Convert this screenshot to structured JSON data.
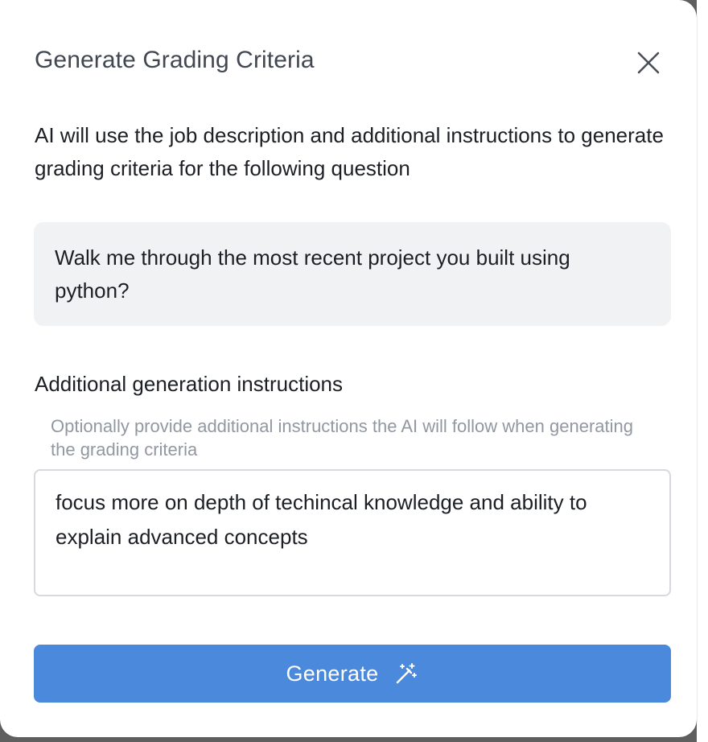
{
  "dialog": {
    "title": "Generate Grading Criteria",
    "close_icon": "close-icon",
    "description": "AI will use the job description and additional instructions to generate grading criteria for the following question",
    "question": "Walk me through the most recent project you built using python?",
    "instructions": {
      "label": "Additional generation instructions",
      "helper": "Optionally provide additional instructions the AI will follow when generating the grading criteria",
      "value": "focus more on depth of techincal knowledge and ability to explain advanced concepts"
    },
    "generate_button": {
      "label": "Generate",
      "icon": "magic-wand-icon"
    }
  },
  "colors": {
    "primary": "#4a89dc",
    "question_bg": "#f1f2f4",
    "title_text": "#424852",
    "helper_text": "#9298a1"
  }
}
